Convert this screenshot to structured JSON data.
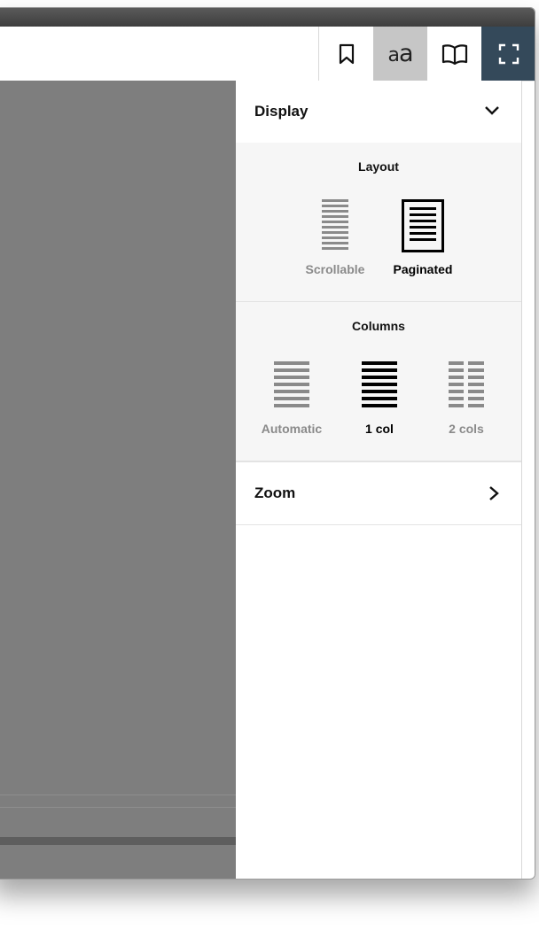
{
  "toolbar": {
    "bookmark_icon": "bookmark-icon",
    "aa_text_small": "a",
    "aa_text_large": "a",
    "book_icon": "open-book-icon",
    "fullscreen_icon": "fullscreen-icon"
  },
  "panel": {
    "display_title": "Display",
    "layout": {
      "title": "Layout",
      "options": [
        {
          "label": "Scrollable",
          "selected": false
        },
        {
          "label": "Paginated",
          "selected": true
        }
      ]
    },
    "columns": {
      "title": "Columns",
      "options": [
        {
          "label": "Automatic",
          "selected": false
        },
        {
          "label": "1 col",
          "selected": true
        },
        {
          "label": "2 cols",
          "selected": false
        }
      ]
    },
    "zoom_title": "Zoom"
  },
  "colors": {
    "fullscreen_bg": "#34495a",
    "active_tab_bg": "#c6c6c6",
    "content_bg": "#7e7e7e",
    "muted_text": "#8a8a8a"
  }
}
